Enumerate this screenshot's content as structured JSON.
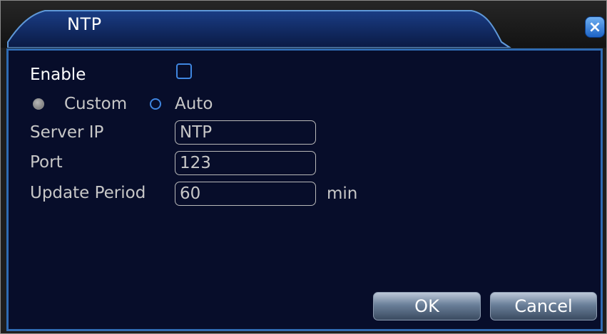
{
  "window": {
    "title": "NTP",
    "close_symbol": "×"
  },
  "form": {
    "enable_label": "Enable",
    "enable_checked": false,
    "mode_options": [
      {
        "label": "Custom",
        "selected": true
      },
      {
        "label": "Auto",
        "selected": false
      }
    ],
    "server_ip": {
      "label": "Server IP",
      "value": "NTP"
    },
    "port": {
      "label": "Port",
      "value": "123"
    },
    "update_period": {
      "label": "Update Period",
      "value": "60",
      "unit": "min"
    }
  },
  "buttons": {
    "ok_label": "OK",
    "cancel_label": "Cancel"
  },
  "colors": {
    "panel_background": "#070d2a",
    "accent_blue": "#3f86e0",
    "label_gray": "#c7c7c7"
  }
}
